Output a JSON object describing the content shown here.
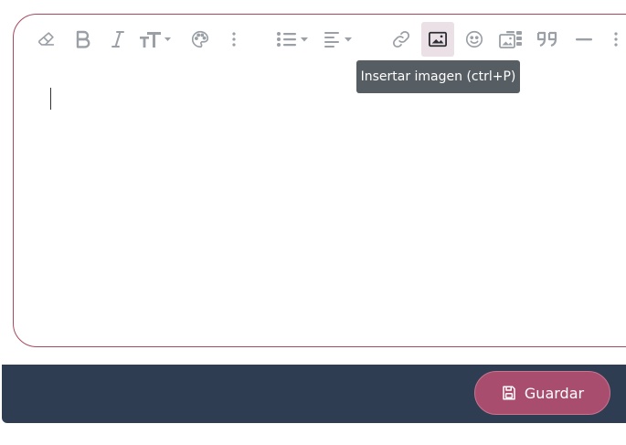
{
  "toolbar": {
    "buttons": [
      {
        "name": "eraser-icon",
        "title": "Eliminar formato"
      },
      {
        "name": "bold-icon",
        "title": "Negrita"
      },
      {
        "name": "italic-icon",
        "title": "Cursiva"
      },
      {
        "name": "text-size-icon",
        "title": "Tamaño de texto"
      },
      {
        "name": "palette-icon",
        "title": "Color"
      },
      {
        "name": "list-icon",
        "title": "Lista"
      },
      {
        "name": "align-icon",
        "title": "Alinear"
      },
      {
        "name": "link-icon",
        "title": "Enlace"
      },
      {
        "name": "image-icon",
        "title": "Insertar imagen"
      },
      {
        "name": "emoji-icon",
        "title": "Emoji"
      },
      {
        "name": "gallery-icon",
        "title": "Galería"
      },
      {
        "name": "quote-icon",
        "title": "Cita"
      },
      {
        "name": "horizontal-rule-icon",
        "title": "Línea horizontal"
      }
    ],
    "active": "image-icon"
  },
  "tooltip": {
    "text": "Insertar imagen (ctrl+P)"
  },
  "editor": {
    "content": ""
  },
  "footer": {
    "save_label": "Guardar"
  },
  "colors": {
    "accent": "#a94d6e",
    "editor_border": "#a6495f",
    "footer_bg": "#2e3d51",
    "tooltip_bg": "#565e64",
    "icon": "#9aa0a6"
  }
}
